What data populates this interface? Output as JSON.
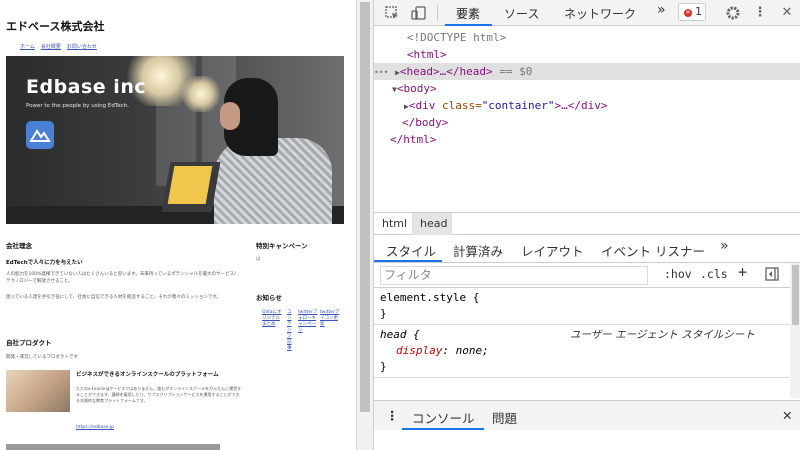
{
  "site": {
    "title": "エドベース株式会社",
    "nav": [
      "ホーム",
      "会社概要",
      "お問い合わせ"
    ],
    "hero_brand": "Edbase inc",
    "hero_tagline": "Power to the people by using EdTech.",
    "philosophy_heading": "会社理念",
    "philosophy_subheading": "EdTechで人々に力を与えたい",
    "philosophy_text1": "人の能力を100%発揮できていない人はたくさんいると思います。未来持っているポテンシャルを最大のサービス/テクノロジーで解放させること。",
    "philosophy_text2": "困っている人達を手引き役にして、社会に自信できる人材を創造すること。それが我々のミッションです。",
    "campaign_heading": "特別キャンペーン",
    "campaign_text": "以",
    "news_heading": "お知らせ",
    "news_links": [
      "Qiitaにオリジナルまとめ",
      "コンテンツ記事",
      "twitterフォローキャンペーン",
      "twitterアイコン更新"
    ],
    "product_heading": "自社プロダクト",
    "product_text": "開発・運営しているプロダクトです",
    "product_title": "ビジネスができるオンラインスクールのプラットフォーム",
    "product_desc": "ただのe-Learningサービスではありません。誰もがオンラインスクールをかんたんに運営することができます。講師を雇用したり、サブスクリプションサービスを運用することができる本格的な教育プラットフォームです。",
    "product_link": "https://edbase.jp"
  },
  "devtools": {
    "tabs": [
      "要素",
      "ソース",
      "ネットワーク"
    ],
    "more_tabs": "»",
    "error_count": "1",
    "dom": {
      "doctype": "<!DOCTYPE html>",
      "html_open": "<html>",
      "head_line": "<head>…</head>",
      "head_suffix": "== $0",
      "ellipsis": "•••",
      "body_open": "<body>",
      "div_tag_open": "<div",
      "div_attr": " class=",
      "div_val": "\"container\"",
      "div_tail": ">…</div>",
      "body_close": "</body>",
      "html_close": "</html>"
    },
    "breadcrumbs": [
      "html",
      "head"
    ],
    "panel_tabs": [
      "スタイル",
      "計算済み",
      "レイアウト",
      "イベント リスナー"
    ],
    "panel_more": "»",
    "filter_placeholder": "フィルタ",
    "hov": ":hov",
    "cls": ".cls",
    "plus": "+",
    "styles": {
      "element_style": "element.style {",
      "close_brace": "}",
      "head_selector": "head {",
      "ua_label": "ユーザー エージェント スタイルシート",
      "declaration_prop": "display",
      "declaration_val": "none;"
    },
    "drawer_tabs": [
      "コンソール",
      "問題"
    ],
    "drawer_close": "✕"
  }
}
